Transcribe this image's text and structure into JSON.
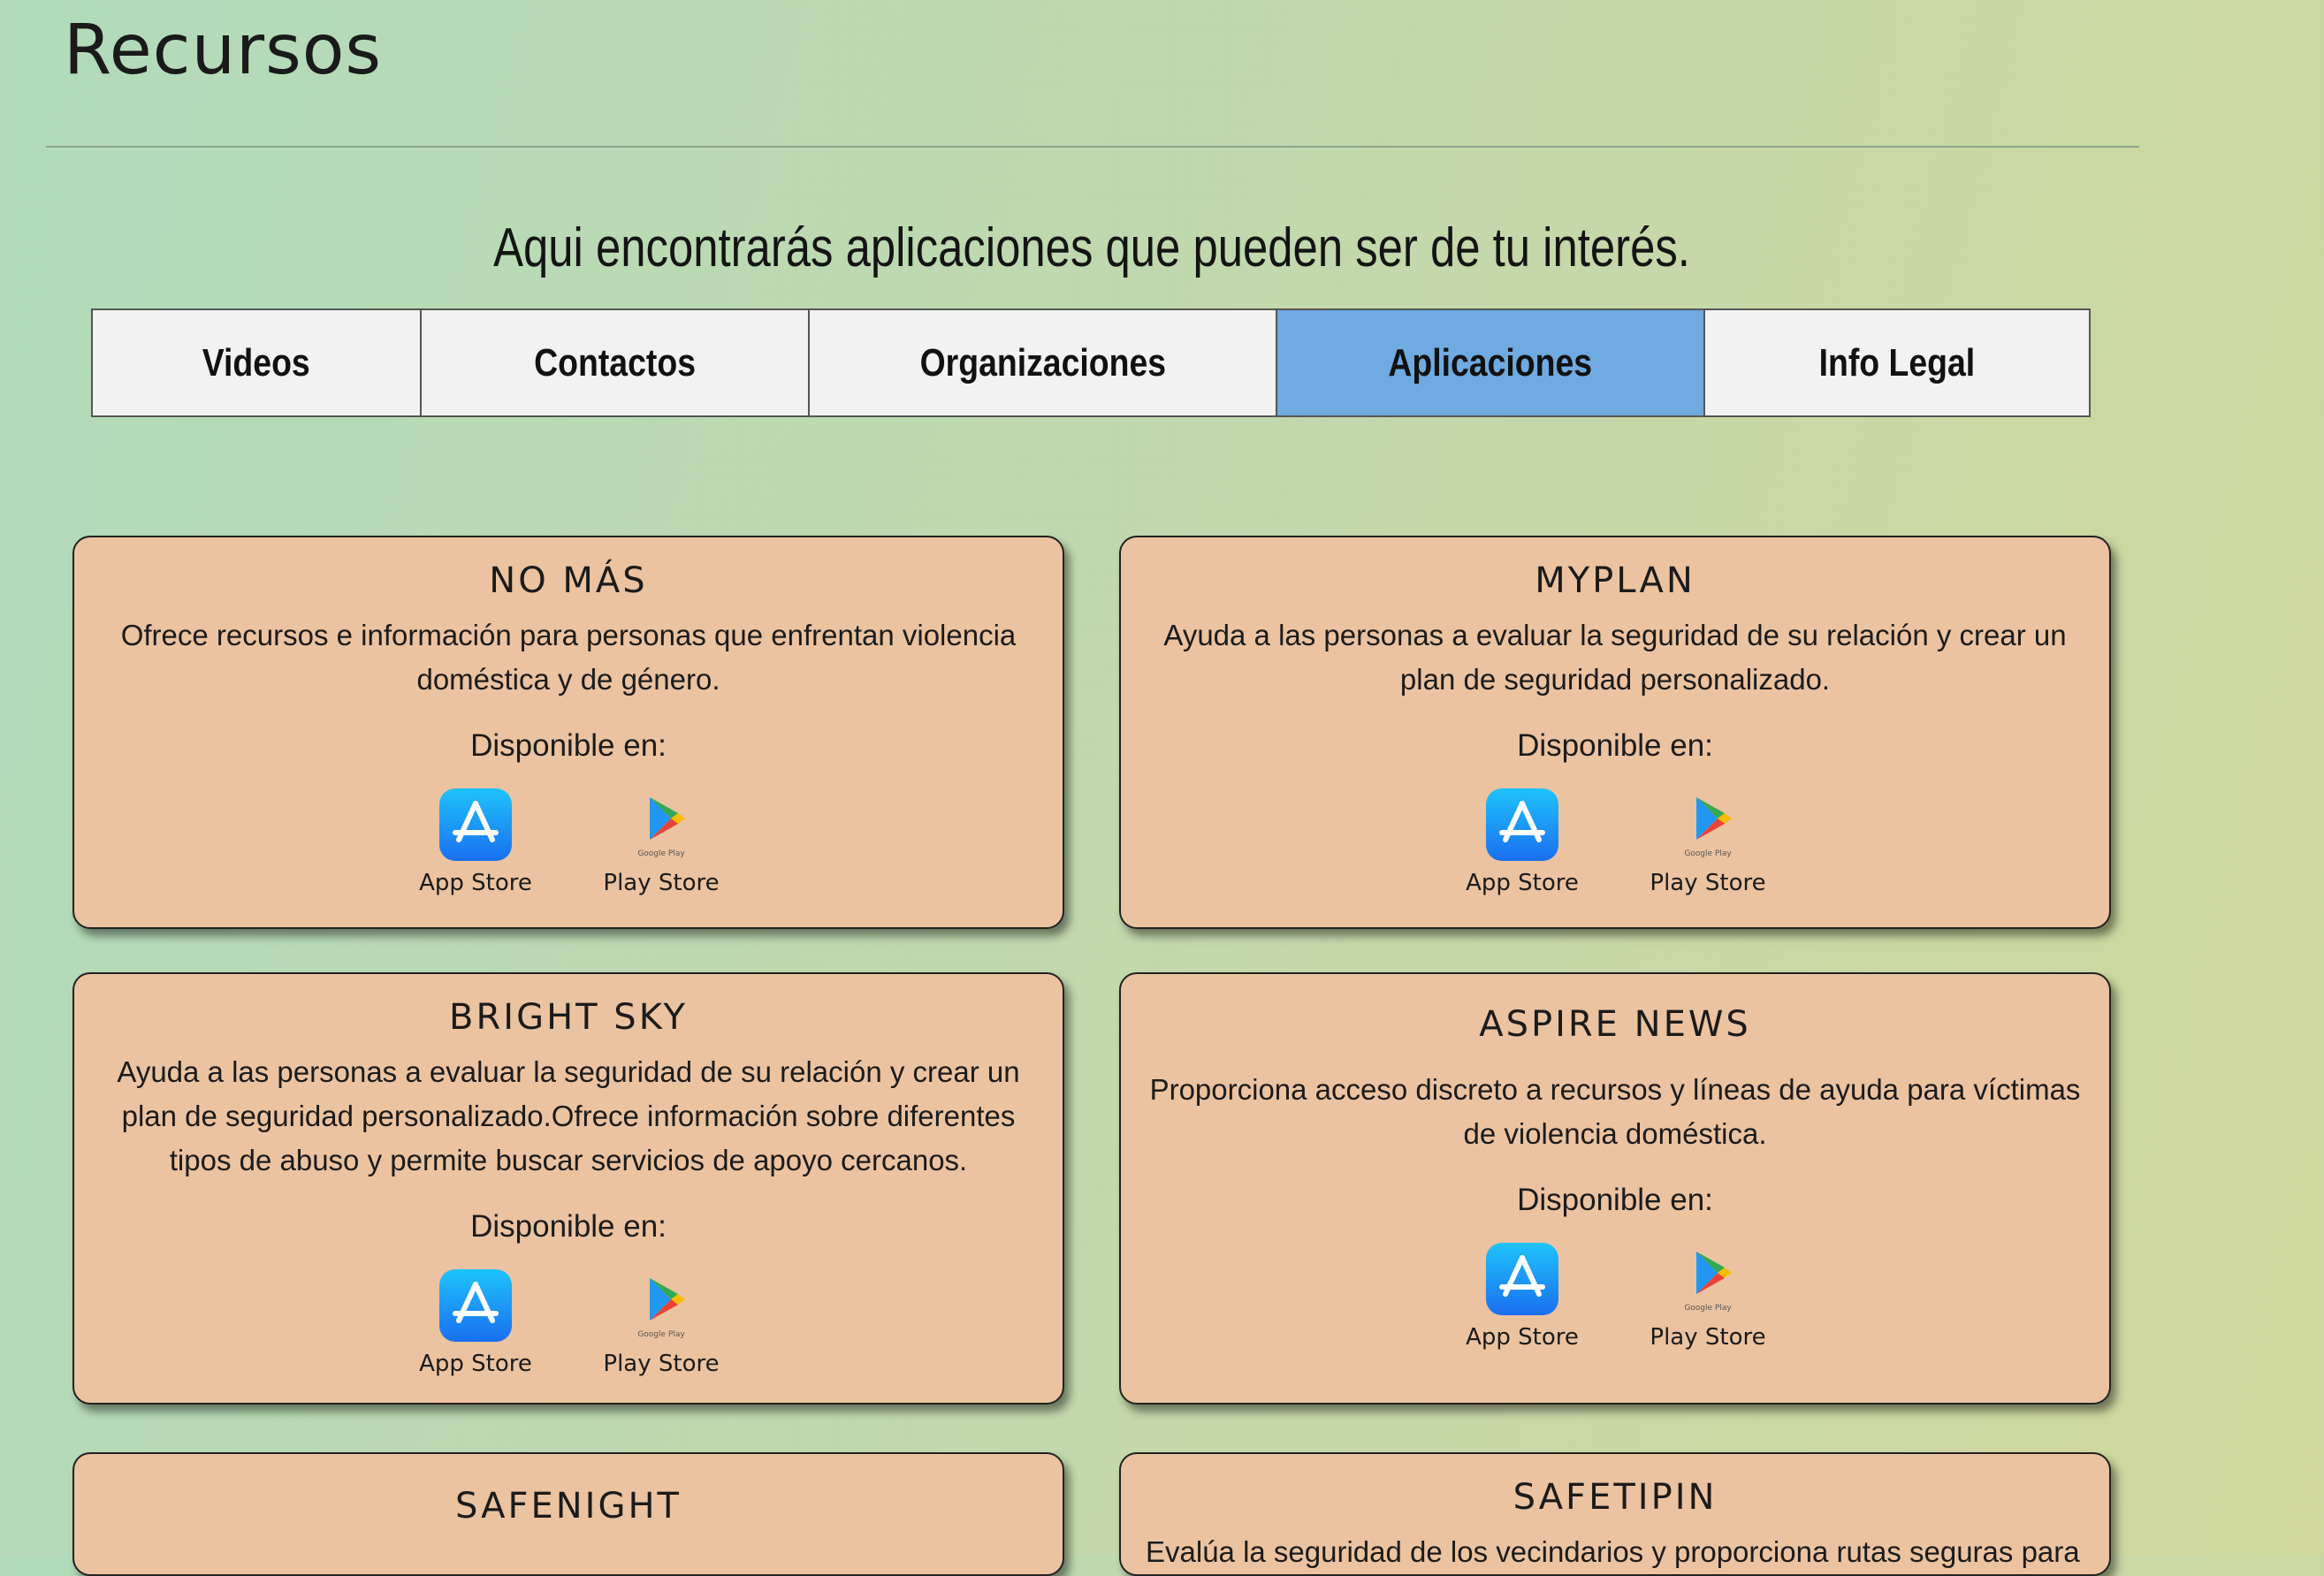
{
  "header": {
    "title": "Recursos"
  },
  "intro_text": "Aqui encontrarás aplicaciones que pueden ser de tu interés.",
  "tabs": [
    {
      "label": "Videos",
      "active": false
    },
    {
      "label": "Contactos",
      "active": false
    },
    {
      "label": "Organizaciones",
      "active": false
    },
    {
      "label": "Aplicaciones",
      "active": true
    },
    {
      "label": "Info Legal",
      "active": false
    }
  ],
  "availability_label": "Disponible en:",
  "stores": {
    "app_store": {
      "label": "App Store",
      "icon": "app-store-icon"
    },
    "play_store": {
      "label": "Play Store",
      "icon": "google-play-icon",
      "icon_caption": "Google Play"
    }
  },
  "apps": [
    {
      "title": "NO MÁS",
      "description": "Ofrece recursos e información para personas que enfrentan violencia doméstica y de género."
    },
    {
      "title": "MYPLAN",
      "description": "Ayuda a las personas a evaluar la seguridad de su relación y crear un plan de seguridad personalizado."
    },
    {
      "title": "BRIGHT SKY",
      "description": "Ayuda a las personas a evaluar la seguridad de su relación y crear un plan de seguridad personalizado.Ofrece información sobre diferentes tipos de abuso y permite buscar servicios de apoyo cercanos."
    },
    {
      "title": "ASPIRE NEWS",
      "description": "Proporciona acceso discreto a recursos y líneas de ayuda para víctimas de violencia doméstica."
    },
    {
      "title": "SAFENIGHT",
      "description": ""
    },
    {
      "title": "SAFETIPIN",
      "description": "Evalúa la seguridad de los vecindarios y proporciona rutas seguras para evitar áreas"
    }
  ],
  "colors": {
    "card_bg": "#ebc3a0",
    "tab_active": "#6faae0",
    "tab_inactive": "#f2f2f2"
  }
}
